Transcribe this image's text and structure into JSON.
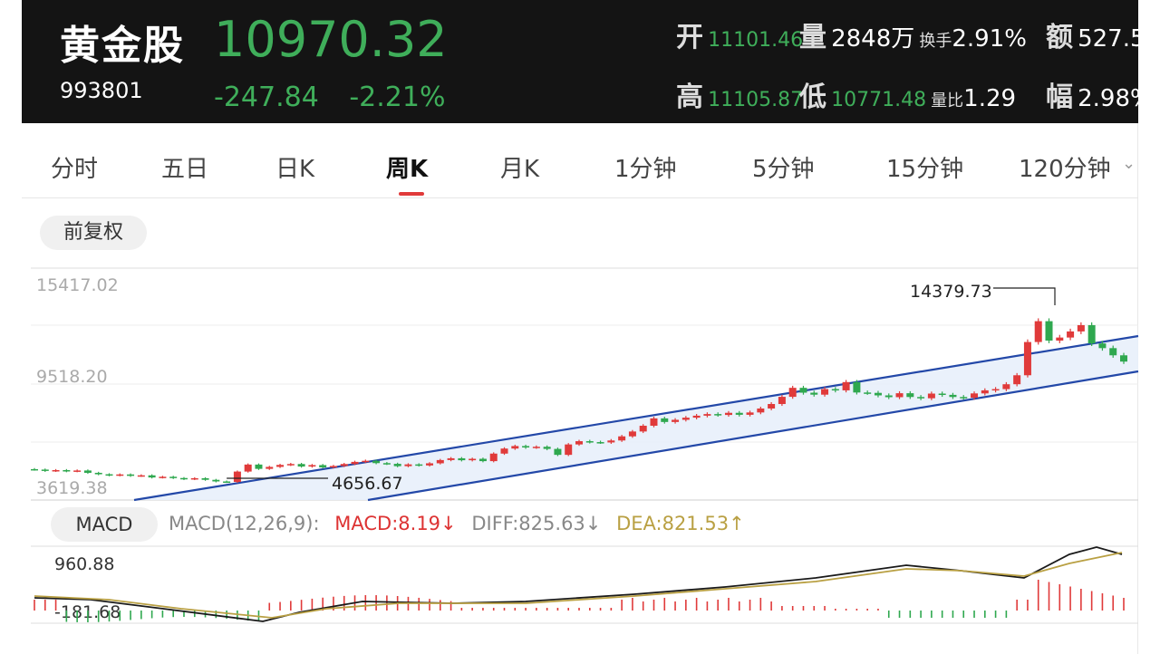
{
  "header": {
    "name": "黄金股",
    "code": "993801",
    "price": "10970.32",
    "change": "-247.84",
    "change_pct": "-2.21%",
    "open_label": "开",
    "open": "11101.46",
    "vol_label": "量",
    "vol": "2848万",
    "turnover_label": "换手",
    "turnover": "2.91%",
    "amount_label": "额",
    "amount": "527.5",
    "high_label": "高",
    "high": "11105.87",
    "low_label": "低",
    "low": "10771.48",
    "volratio_label": "量比",
    "volratio": "1.29",
    "amp_label": "幅",
    "amp": "2.98%"
  },
  "tabs": [
    {
      "label": "分时"
    },
    {
      "label": "五日"
    },
    {
      "label": "日K"
    },
    {
      "label": "周K"
    },
    {
      "label": "月K"
    },
    {
      "label": "1分钟"
    },
    {
      "label": "5分钟"
    },
    {
      "label": "15分钟"
    },
    {
      "label": "120分钟"
    }
  ],
  "active_tab": "周K",
  "adjust_label": "前复权",
  "chart": {
    "y_labels": [
      "15417.02",
      "9518.20",
      "3619.38"
    ],
    "annot_high": "14379.73",
    "annot_low": "4656.67"
  },
  "macd": {
    "button": "MACD",
    "params": "MACD(12,26,9):",
    "macd": "MACD:8.19↓",
    "diff": "DIFF:825.63↓",
    "dea": "DEA:821.53↑",
    "y_top": "960.88",
    "y_bottom": "-181.68"
  },
  "colors": {
    "up": "#e03a3a",
    "down": "#2fa84f",
    "channel": "#2348a8",
    "dea": "#b9a043",
    "diff": "#1a1a1a"
  },
  "chart_data": {
    "type": "candlestick",
    "ylim": [
      3619.38,
      15417.02
    ],
    "closes": [
      4960,
      4890,
      4930,
      4870,
      4910,
      4780,
      4700,
      4640,
      4690,
      4610,
      4640,
      4520,
      4560,
      4490,
      4430,
      4480,
      4390,
      4300,
      4270,
      4850,
      5240,
      5000,
      5110,
      5220,
      5270,
      5130,
      5210,
      5080,
      5160,
      5270,
      5390,
      5450,
      5320,
      5280,
      5150,
      5250,
      5190,
      5310,
      5490,
      5590,
      5480,
      5560,
      5430,
      5850,
      6130,
      6270,
      6190,
      6230,
      6110,
      5780,
      6360,
      6540,
      6490,
      6470,
      6580,
      6810,
      7080,
      7400,
      7810,
      7610,
      7730,
      7850,
      7960,
      8050,
      8000,
      8120,
      8010,
      8140,
      8360,
      8610,
      9010,
      9510,
      9240,
      9130,
      9440,
      9370,
      9830,
      9250,
      9230,
      9090,
      8990,
      9210,
      9000,
      8930,
      9190,
      9120,
      9000,
      8960,
      9200,
      9370,
      9440,
      9710,
      10210,
      12060,
      13220,
      12140,
      12310,
      12650,
      13000,
      11980,
      11720,
      11320,
      10970
    ]
  }
}
